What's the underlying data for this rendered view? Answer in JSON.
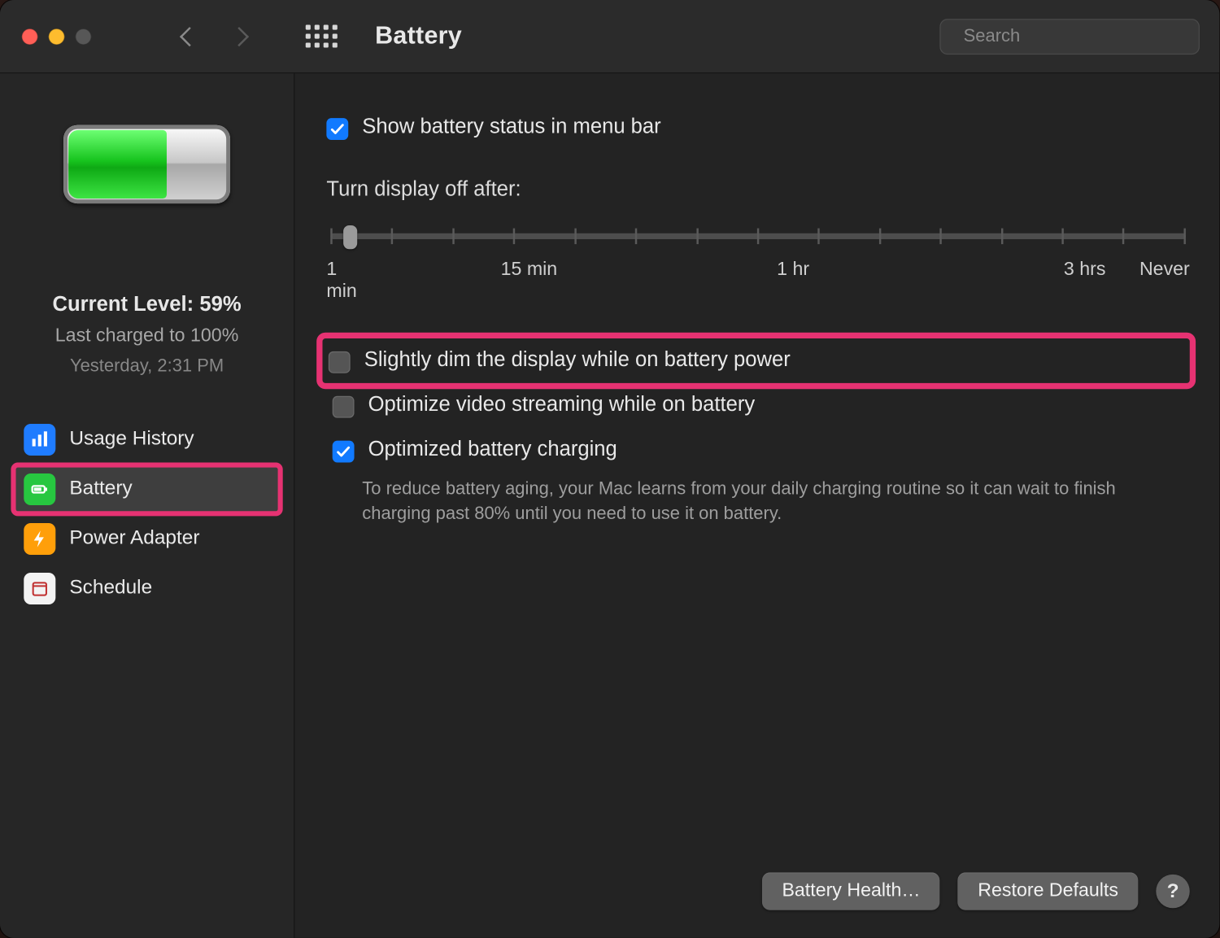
{
  "window": {
    "title": "Battery"
  },
  "search": {
    "placeholder": "Search"
  },
  "sidebar": {
    "current_level_label": "Current Level:",
    "current_level_value": "59%",
    "last_charged": "Last charged to 100%",
    "last_charged_time": "Yesterday, 2:31 PM",
    "items": [
      {
        "label": "Usage History"
      },
      {
        "label": "Battery"
      },
      {
        "label": "Power Adapter"
      },
      {
        "label": "Schedule"
      }
    ],
    "selected_index": 1
  },
  "settings": {
    "show_status": {
      "checked": true,
      "label": "Show battery status in menu bar"
    },
    "turn_off_label": "Turn display off after:",
    "slider": {
      "ticks": 15,
      "value_index": 0,
      "labels": [
        "1 min",
        "15 min",
        "1 hr",
        "3 hrs",
        "Never"
      ]
    },
    "dim": {
      "checked": false,
      "label": "Slightly dim the display while on battery power"
    },
    "optimize_video": {
      "checked": false,
      "label": "Optimize video streaming while on battery"
    },
    "optimized_charging": {
      "checked": true,
      "label": "Optimized battery charging",
      "desc": "To reduce battery aging, your Mac learns from your daily charging routine so it can wait to finish charging past 80% until you need to use it on battery."
    }
  },
  "footer": {
    "battery_health": "Battery Health…",
    "restore_defaults": "Restore Defaults",
    "help": "?"
  }
}
